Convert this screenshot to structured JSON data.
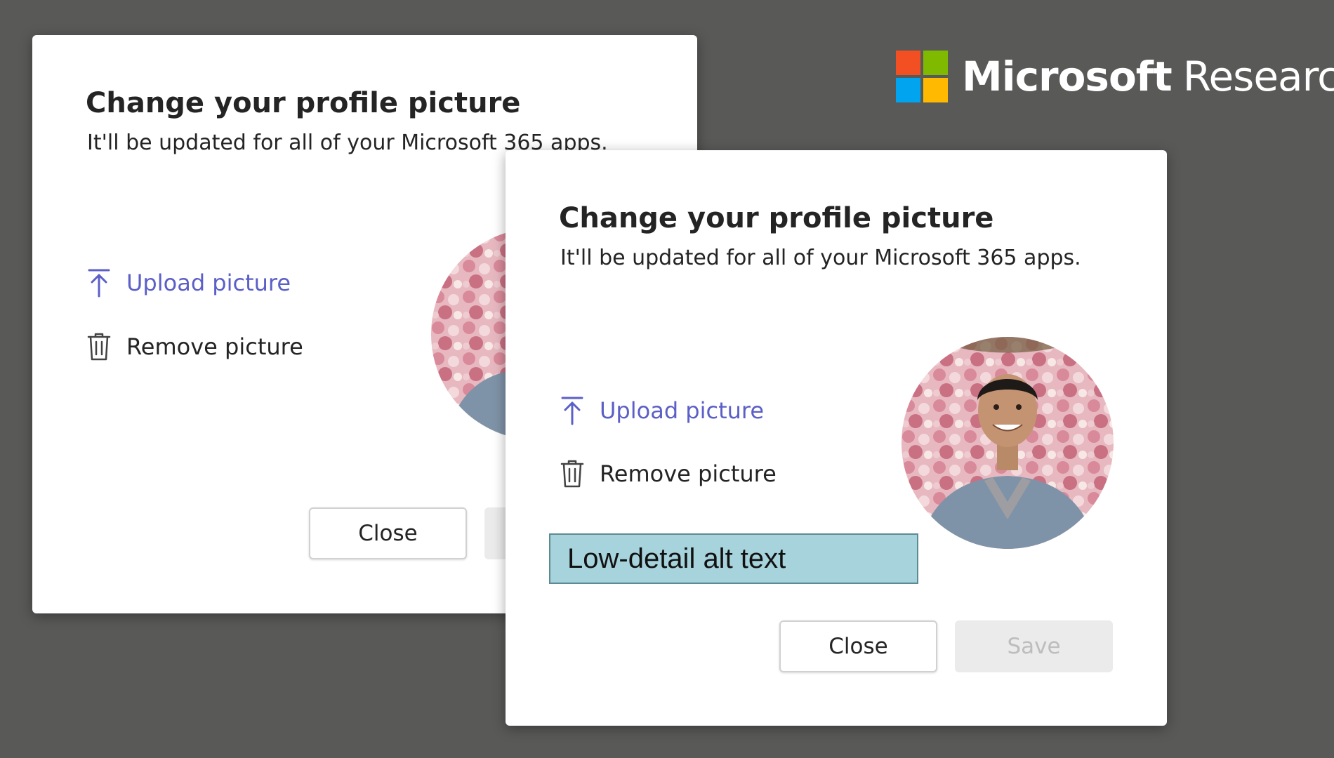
{
  "brand": {
    "name_primary": "Microsoft",
    "name_secondary": "Research",
    "logo_colors": [
      "#f25022",
      "#7fba00",
      "#00a4ef",
      "#ffb900"
    ]
  },
  "dialog_back": {
    "title": "Change your profile picture",
    "subtitle": "It'll be updated for all of your Microsoft 365 apps.",
    "upload_label": "Upload picture",
    "remove_label": "Remove picture",
    "close_label": "Close"
  },
  "dialog_front": {
    "title": "Change your profile picture",
    "subtitle": "It'll be updated for all of your Microsoft 365 apps.",
    "upload_label": "Upload picture",
    "remove_label": "Remove picture",
    "alt_text_label": "Low-detail alt text",
    "close_label": "Close",
    "save_label": "Save"
  },
  "colors": {
    "accent": "#5b5fc7",
    "background": "#595958",
    "annotation_fill": "#a7d3dc"
  },
  "icons": {
    "upload": "upload-arrow-icon",
    "remove": "trash-icon"
  }
}
